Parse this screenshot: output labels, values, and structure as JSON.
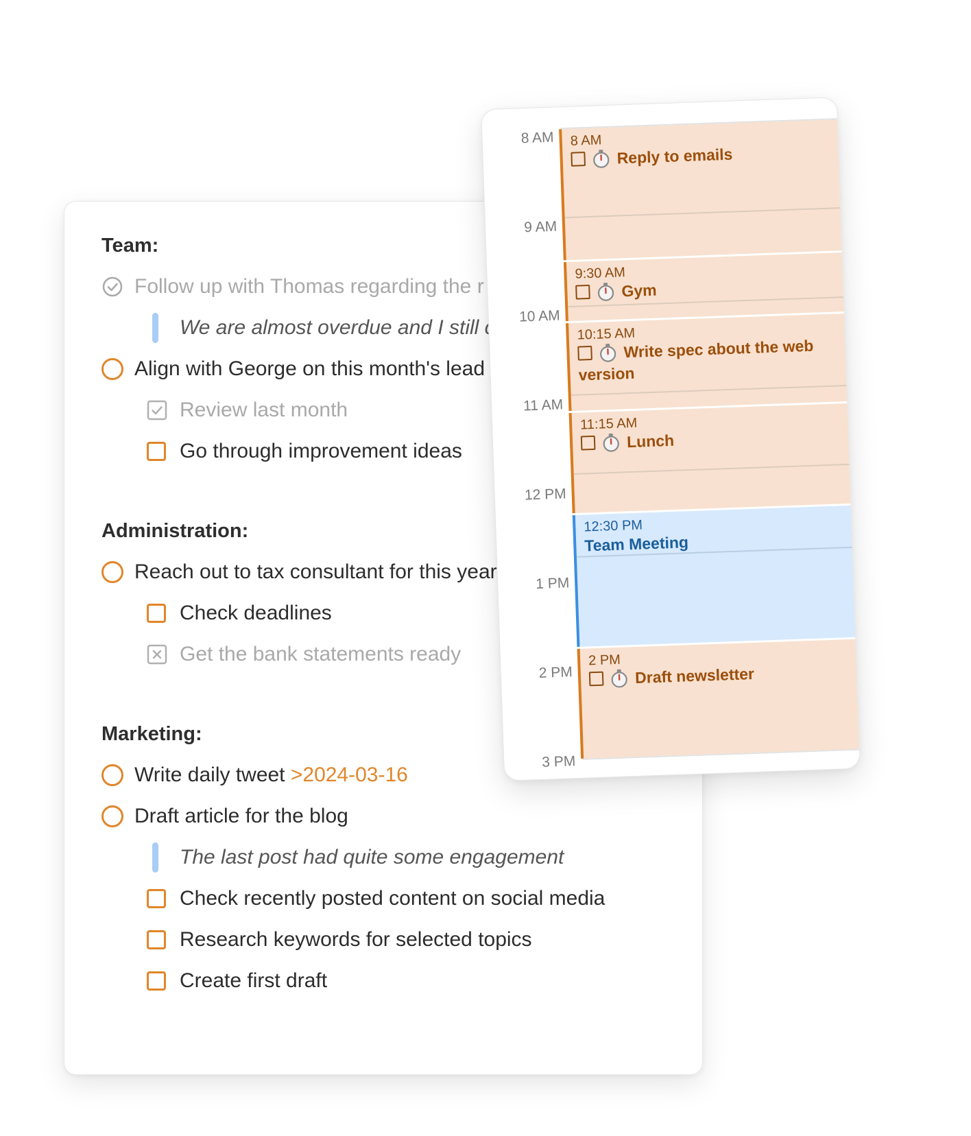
{
  "notes": {
    "sections": [
      {
        "heading": "Team:",
        "items": [
          {
            "type": "task",
            "state": "done",
            "text": "Follow up with Thomas regarding the r"
          },
          {
            "type": "quote",
            "text": "We are almost overdue and I still c"
          },
          {
            "type": "task",
            "state": "open",
            "text": "Align with George on this month's lead"
          },
          {
            "type": "subtask",
            "state": "done",
            "text": "Review last month"
          },
          {
            "type": "subtask",
            "state": "open",
            "text": "Go through improvement ideas"
          }
        ]
      },
      {
        "heading": "Administration:",
        "items": [
          {
            "type": "task",
            "state": "open",
            "text": "Reach out to tax consultant for this year"
          },
          {
            "type": "subtask",
            "state": "open",
            "text": "Check deadlines"
          },
          {
            "type": "subtask",
            "state": "cancelled",
            "text": "Get the bank statements ready"
          }
        ]
      },
      {
        "heading": "Marketing:",
        "items": [
          {
            "type": "task",
            "state": "open",
            "text": "Write daily tweet ",
            "date": ">2024-03-16"
          },
          {
            "type": "task",
            "state": "open",
            "text": "Draft article for the blog"
          },
          {
            "type": "quote",
            "text": "The last post had quite some engagement"
          },
          {
            "type": "subtask",
            "state": "open",
            "text": "Check recently posted content on social media"
          },
          {
            "type": "subtask",
            "state": "open",
            "text": "Research keywords for selected topics"
          },
          {
            "type": "subtask",
            "state": "open",
            "text": "Create first draft"
          }
        ]
      }
    ]
  },
  "calendar": {
    "hours": [
      "8 AM",
      "9 AM",
      "10 AM",
      "11 AM",
      "12 PM",
      "1 PM",
      "2 PM",
      "3 PM"
    ],
    "events": [
      {
        "time": "8 AM",
        "title": "Reply to emails",
        "kind": "task"
      },
      {
        "time": "9:30 AM",
        "title": "Gym",
        "kind": "task"
      },
      {
        "time": "10:15 AM",
        "title": "Write spec about the web version",
        "kind": "task"
      },
      {
        "time": "11:15 AM",
        "title": "Lunch",
        "kind": "task"
      },
      {
        "time": "12:30 PM",
        "title": "Team Meeting",
        "kind": "meeting"
      },
      {
        "time": "2 PM",
        "title": "Draft newsletter",
        "kind": "task"
      }
    ],
    "colors": {
      "task_bg": "#f8e1d0",
      "task_accent": "#d97a1e",
      "meeting_bg": "#d7e9fc",
      "meeting_accent": "#3b8fe0"
    }
  }
}
